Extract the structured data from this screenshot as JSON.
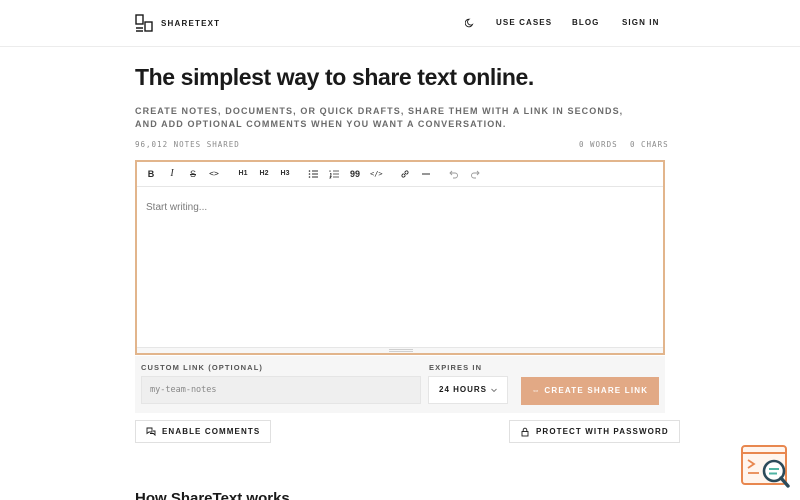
{
  "brand": {
    "name": "SHARETEXT",
    "icon": "logo-mark"
  },
  "nav": {
    "theme_icon": "moon-icon",
    "items": [
      "USE CASES",
      "BLOG",
      "SIGN IN"
    ]
  },
  "hero": {
    "title": "The simplest way to share text online.",
    "subtitle": "CREATE NOTES, DOCUMENTS, OR QUICK DRAFTS, SHARE THEM WITH A LINK IN SECONDS, AND ADD OPTIONAL COMMENTS WHEN YOU WANT A CONVERSATION."
  },
  "stats": {
    "notes_shared": "96,012 NOTES SHARED",
    "words": "0 WORDS",
    "chars": "0 CHARS"
  },
  "toolbar": {
    "buttons": [
      "bold-icon",
      "italic-icon",
      "strikethrough-icon",
      "code-icon",
      "heading1-icon",
      "heading2-icon",
      "heading3-icon",
      "bullet-list-icon",
      "ordered-list-icon",
      "blockquote-icon",
      "code-block-icon",
      "link-icon",
      "horizontal-rule-icon",
      "undo-icon",
      "redo-icon"
    ],
    "bold": "B",
    "italic": "I",
    "strike": "S",
    "code": "<>",
    "h1": "H1",
    "h2": "H2",
    "h3": "H3",
    "quote": "99",
    "codeblock": "</>"
  },
  "editor": {
    "placeholder": "Start writing..."
  },
  "options": {
    "custom_link_label": "CUSTOM LINK (OPTIONAL)",
    "custom_link_placeholder": "my-team-notes",
    "expires_label": "EXPIRES IN",
    "expires_value": "24 HOURS",
    "create_button": "CREATE SHARE LINK",
    "enable_comments": "ENABLE COMMENTS",
    "protect_password": "PROTECT WITH PASSWORD"
  },
  "section": {
    "how_title": "How ShareText works"
  },
  "colors": {
    "accent": "#e2a985",
    "editor_border": "#e2b58c",
    "badge": "#e8874f"
  }
}
